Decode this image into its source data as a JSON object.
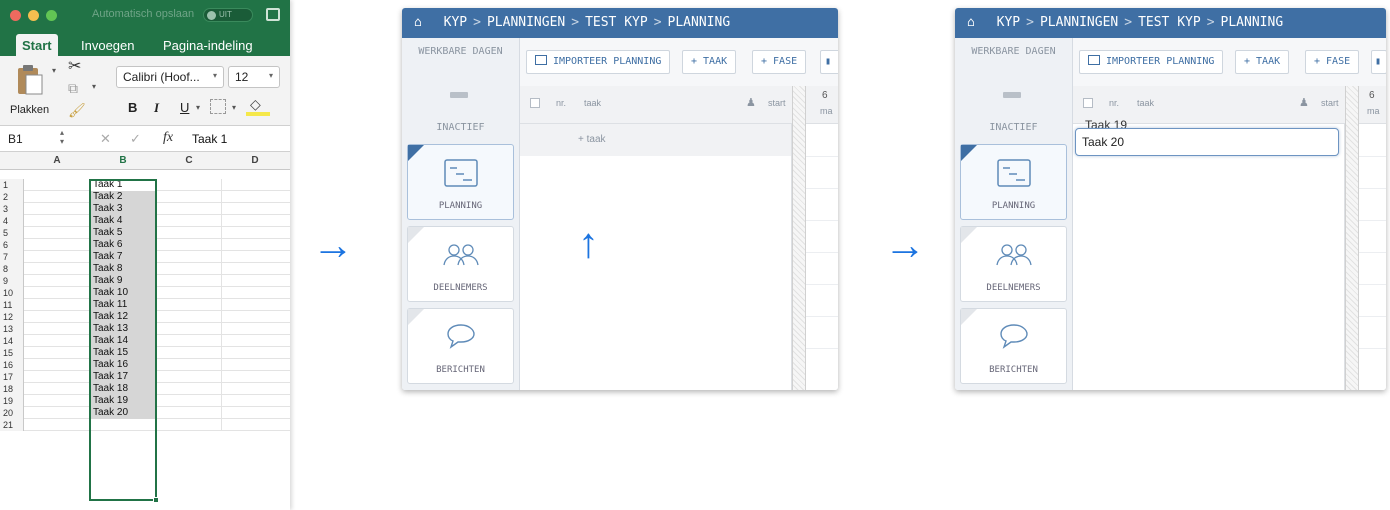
{
  "excel": {
    "autosave_label": "Automatisch opslaan",
    "toggle_label": "UIT",
    "tabs": [
      "Start",
      "Invoegen",
      "Pagina-indeling"
    ],
    "paste_label": "Plakken",
    "font_name": "Calibri (Hoof...",
    "font_size": "12",
    "bold": "B",
    "italic": "I",
    "underline": "U",
    "cell_ref": "B1",
    "fx_label": "fx",
    "formula_value": "Taak 1",
    "columns": [
      "A",
      "B",
      "C",
      "D"
    ],
    "rows": [
      {
        "n": "1",
        "b": "Taak 1"
      },
      {
        "n": "2",
        "b": "Taak 2"
      },
      {
        "n": "3",
        "b": "Taak 3"
      },
      {
        "n": "4",
        "b": "Taak 4"
      },
      {
        "n": "5",
        "b": "Taak 5"
      },
      {
        "n": "6",
        "b": "Taak 6"
      },
      {
        "n": "7",
        "b": "Taak 7"
      },
      {
        "n": "8",
        "b": "Taak 8"
      },
      {
        "n": "9",
        "b": "Taak 9"
      },
      {
        "n": "10",
        "b": "Taak 10"
      },
      {
        "n": "11",
        "b": "Taak 11"
      },
      {
        "n": "12",
        "b": "Taak 12"
      },
      {
        "n": "13",
        "b": "Taak 13"
      },
      {
        "n": "14",
        "b": "Taak 14"
      },
      {
        "n": "15",
        "b": "Taak 15"
      },
      {
        "n": "16",
        "b": "Taak 16"
      },
      {
        "n": "17",
        "b": "Taak 17"
      },
      {
        "n": "18",
        "b": "Taak 18"
      },
      {
        "n": "19",
        "b": "Taak 19"
      },
      {
        "n": "20",
        "b": "Taak 20"
      },
      {
        "n": "21",
        "b": ""
      }
    ]
  },
  "app": {
    "home_icon": "⌂",
    "breadcrumb": [
      "KYP",
      "PLANNINGEN",
      "TEST KYP",
      "PLANNING"
    ],
    "breadcrumb_sep": ">",
    "left": {
      "workdays": "WERKBARE DAGEN",
      "inactive": "INACTIEF",
      "planning": "PLANNING",
      "participants": "DEELNEMERS",
      "messages": "BERICHTEN"
    },
    "toolbar": {
      "import": "IMPORTEER PLANNING",
      "task": "+ TAAK",
      "phase": "+ FASE"
    },
    "table": {
      "col_nr": "nr.",
      "col_task": "taak",
      "col_start": "start",
      "add_task": "+ taak",
      "day_num": "6",
      "day_abbr": "ma"
    },
    "editing": {
      "prev_value": "Taak 19",
      "value": "Taak 20"
    }
  },
  "colors": {
    "excel_green": "#217346",
    "app_blue": "#3f6fa4",
    "arrow_blue": "#1c74e0"
  },
  "arrows": [
    "→",
    "↑",
    "→"
  ]
}
